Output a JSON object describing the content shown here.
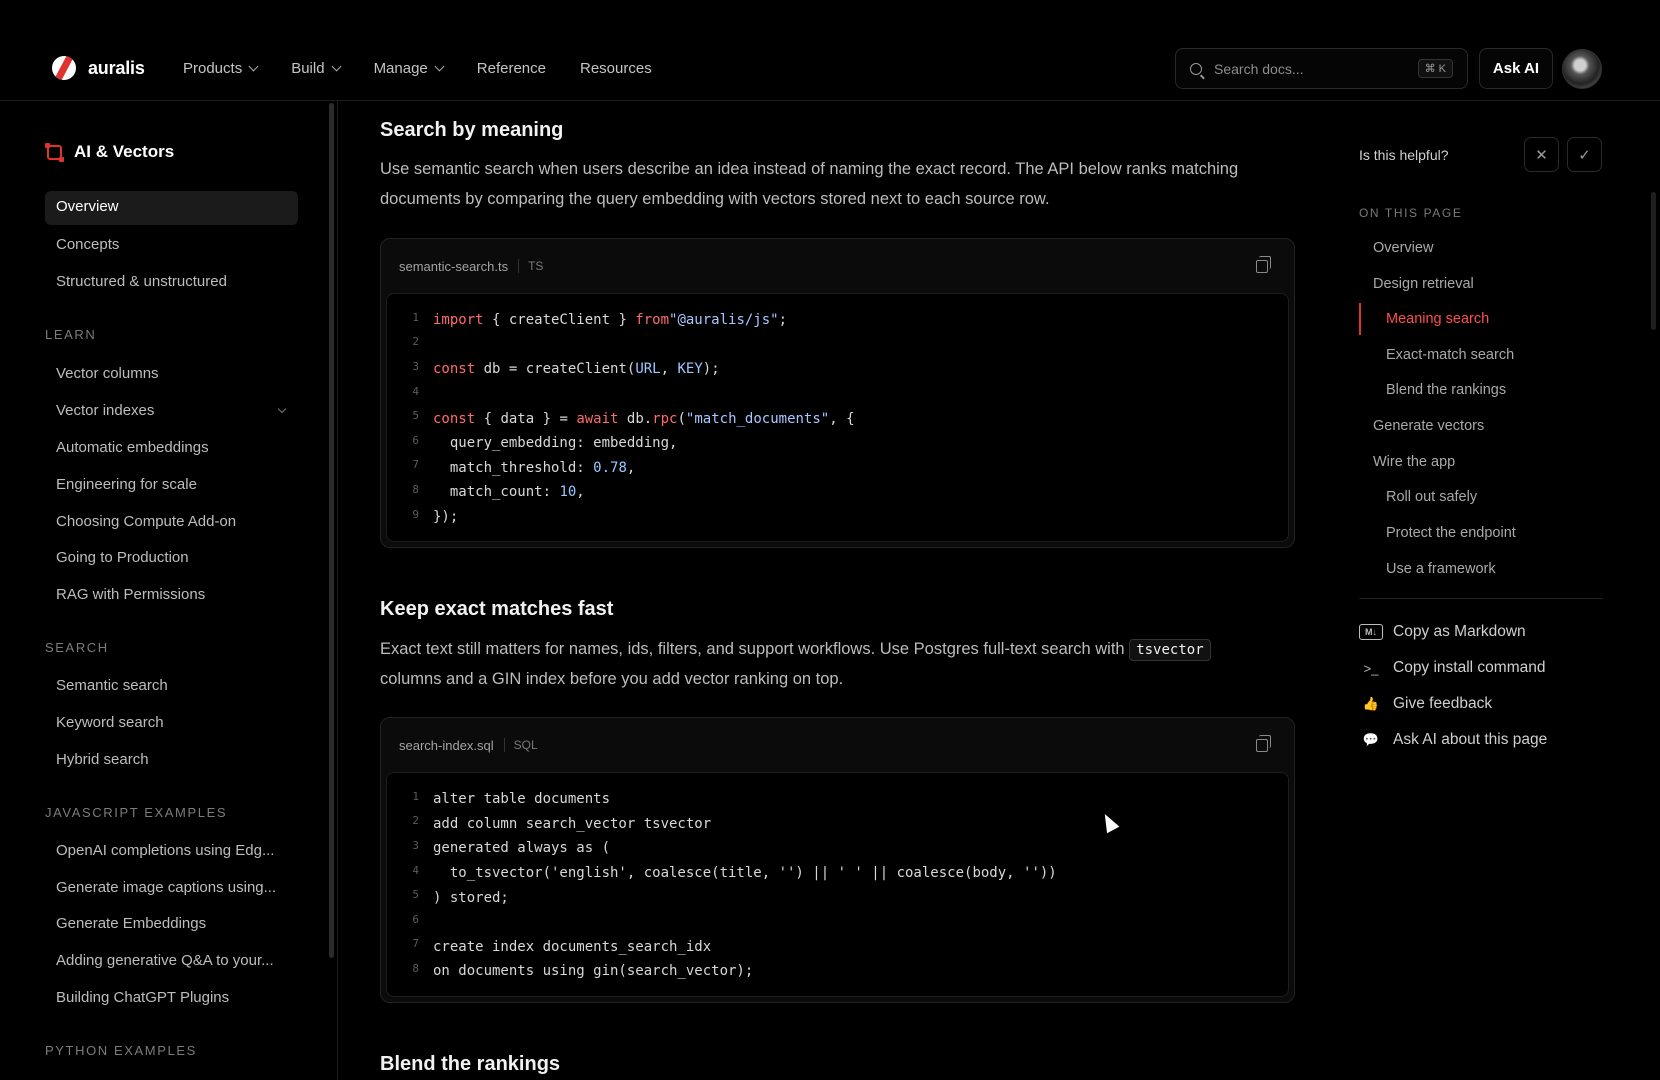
{
  "header": {
    "brand": "auralis",
    "nav": [
      {
        "label": "Products",
        "dropdown": true
      },
      {
        "label": "Build",
        "dropdown": true
      },
      {
        "label": "Manage",
        "dropdown": true
      },
      {
        "label": "Reference",
        "dropdown": false
      },
      {
        "label": "Resources",
        "dropdown": false
      }
    ],
    "search_placeholder": "Search docs...",
    "search_shortcut": "⌘ K",
    "ask_ai": "Ask AI"
  },
  "sidebar": {
    "title": "AI & Vectors",
    "top_items": [
      "Overview",
      "Concepts",
      "Structured & unstructured"
    ],
    "active_item": "Overview",
    "sections": [
      {
        "title": "LEARN",
        "items": [
          "Vector columns",
          "Vector indexes",
          "Automatic embeddings",
          "Engineering for scale",
          "Choosing Compute Add-on",
          "Going to Production",
          "RAG with Permissions"
        ]
      },
      {
        "title": "SEARCH",
        "items": [
          "Semantic search",
          "Keyword search",
          "Hybrid search"
        ]
      },
      {
        "title": "JAVASCRIPT EXAMPLES",
        "items": [
          "OpenAI completions using Edg...",
          "Generate image captions using...",
          "Generate Embeddings",
          "Adding generative Q&A to your...",
          "Building ChatGPT Plugins"
        ]
      },
      {
        "title": "PYTHON EXAMPLES",
        "items": []
      }
    ]
  },
  "main": {
    "section1": {
      "heading": "Search by meaning",
      "paragraph": "Use semantic search when users describe an idea instead of naming the exact record. The API below ranks matching documents by comparing the query embedding with vectors stored next to each source row.",
      "code": {
        "filename": "semantic-search.ts",
        "lang": "TS",
        "lines": [
          "1",
          "2",
          "3",
          "4",
          "5",
          "6",
          "7",
          "8",
          "9"
        ]
      }
    },
    "section2": {
      "heading": "Keep exact matches fast",
      "paragraph_before": "Exact text still matters for names, ids, filters, and support workflows. Use Postgres full-text search with",
      "inline_code": "tsvector",
      "paragraph_after": "columns and a GIN index before you add vector ranking on top.",
      "code": {
        "filename": "search-index.sql",
        "lang": "SQL",
        "lines": [
          "alter table documents",
          "add column search_vector tsvector",
          "generated always as (",
          "  to_tsvector('english', coalesce(title, '') || ' ' || coalesce(body, ''))",
          ") stored;",
          "",
          "create index documents_search_idx",
          "on documents using gin(search_vector);"
        ]
      }
    },
    "section3": {
      "heading": "Blend the rankings"
    }
  },
  "right_panel": {
    "helpful_label": "Is this helpful?",
    "on_this_page": "ON THIS PAGE",
    "toc": [
      {
        "label": "Overview",
        "level": 1
      },
      {
        "label": "Design retrieval",
        "level": 1
      },
      {
        "label": "Meaning search",
        "level": 2,
        "active": true
      },
      {
        "label": "Exact-match search",
        "level": 2
      },
      {
        "label": "Blend the rankings",
        "level": 2
      },
      {
        "label": "Generate vectors",
        "level": 1
      },
      {
        "label": "Wire the app",
        "level": 1
      },
      {
        "label": "Roll out safely",
        "level": 2
      },
      {
        "label": "Protect the endpoint",
        "level": 2
      },
      {
        "label": "Use a framework",
        "level": 2
      }
    ],
    "actions": [
      {
        "label": "Copy as Markdown",
        "icon": "markdown-icon"
      },
      {
        "label": "Copy install command",
        "icon": "terminal-icon"
      },
      {
        "label": "Give feedback",
        "icon": "thumbs-up-icon"
      },
      {
        "label": "Ask AI about this page",
        "icon": "chat-bubble-icon"
      }
    ]
  },
  "colors": {
    "accent": "#e0322e",
    "active_link": "#ff4d4d",
    "background": "#000000"
  }
}
